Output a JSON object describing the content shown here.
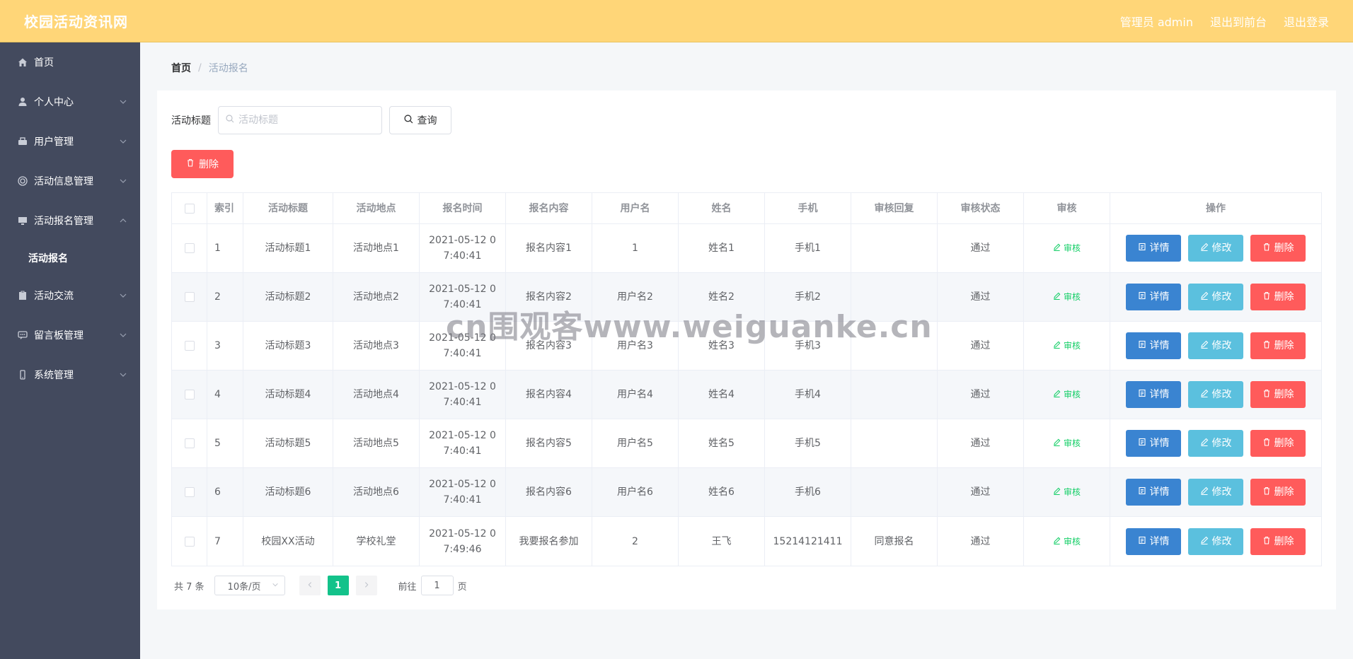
{
  "header": {
    "brand": "校园活动资讯网",
    "admin_label": "管理员 admin",
    "back_front_label": "退出到前台",
    "logout_label": "退出登录"
  },
  "sidebar": {
    "items": [
      {
        "label": "首页",
        "icon": "home-icon"
      },
      {
        "label": "个人中心",
        "icon": "user-icon"
      },
      {
        "label": "用户管理",
        "icon": "users-icon"
      },
      {
        "label": "活动信息管理",
        "icon": "target-icon"
      },
      {
        "label": "活动报名管理",
        "icon": "monitor-icon"
      },
      {
        "label": "活动报名",
        "icon": ""
      },
      {
        "label": "活动交流",
        "icon": "clipboard-icon"
      },
      {
        "label": "留言板管理",
        "icon": "chat-icon"
      },
      {
        "label": "系统管理",
        "icon": "phone-icon"
      }
    ]
  },
  "breadcrumb": {
    "home": "首页",
    "separator": "/",
    "current": "活动报名"
  },
  "search": {
    "label": "活动标题",
    "placeholder": "活动标题",
    "query_button": "查询"
  },
  "toolbar": {
    "delete_label": "删除"
  },
  "table": {
    "headers": [
      "",
      "索引",
      "活动标题",
      "活动地点",
      "报名时间",
      "报名内容",
      "用户名",
      "姓名",
      "手机",
      "审核回复",
      "审核状态",
      "审核",
      "操作"
    ],
    "rows": [
      {
        "idx": "1",
        "title": "活动标题1",
        "place": "活动地点1",
        "time_l1": "2021-05-12 0",
        "time_l2": "7:40:41",
        "content": "报名内容1",
        "username": "1",
        "name": "姓名1",
        "phone": "手机1",
        "reply": "",
        "status": "通过"
      },
      {
        "idx": "2",
        "title": "活动标题2",
        "place": "活动地点2",
        "time_l1": "2021-05-12 0",
        "time_l2": "7:40:41",
        "content": "报名内容2",
        "username": "用户名2",
        "name": "姓名2",
        "phone": "手机2",
        "reply": "",
        "status": "通过"
      },
      {
        "idx": "3",
        "title": "活动标题3",
        "place": "活动地点3",
        "time_l1": "2021-05-12 0",
        "time_l2": "7:40:41",
        "content": "报名内容3",
        "username": "用户名3",
        "name": "姓名3",
        "phone": "手机3",
        "reply": "",
        "status": "通过"
      },
      {
        "idx": "4",
        "title": "活动标题4",
        "place": "活动地点4",
        "time_l1": "2021-05-12 0",
        "time_l2": "7:40:41",
        "content": "报名内容4",
        "username": "用户名4",
        "name": "姓名4",
        "phone": "手机4",
        "reply": "",
        "status": "通过"
      },
      {
        "idx": "5",
        "title": "活动标题5",
        "place": "活动地点5",
        "time_l1": "2021-05-12 0",
        "time_l2": "7:40:41",
        "content": "报名内容5",
        "username": "用户名5",
        "name": "姓名5",
        "phone": "手机5",
        "reply": "",
        "status": "通过"
      },
      {
        "idx": "6",
        "title": "活动标题6",
        "place": "活动地点6",
        "time_l1": "2021-05-12 0",
        "time_l2": "7:40:41",
        "content": "报名内容6",
        "username": "用户名6",
        "name": "姓名6",
        "phone": "手机6",
        "reply": "",
        "status": "通过"
      },
      {
        "idx": "7",
        "title": "校园XX活动",
        "place": "学校礼堂",
        "time_l1": "2021-05-12 0",
        "time_l2": "7:49:46",
        "content": "我要报名参加",
        "username": "2",
        "name": "王飞",
        "phone": "15214121411",
        "reply": "同意报名",
        "status": "通过"
      }
    ],
    "audit_label": "审核",
    "detail_label": "详情",
    "edit_label": "修改",
    "delete_label": "删除"
  },
  "pagination": {
    "total": "共 7 条",
    "page_size": "10条/页",
    "current_page": "1",
    "goto_prefix": "前往",
    "goto_value": "1",
    "goto_suffix": "页"
  },
  "watermark": "cn围观客www.weiguanke.cn",
  "colors": {
    "topbar": "#ffd678",
    "sidebar": "#434a5e",
    "danger": "#ff5b5b",
    "primary": "#3a84d1",
    "info": "#5bc0de",
    "success": "#13c28a"
  }
}
